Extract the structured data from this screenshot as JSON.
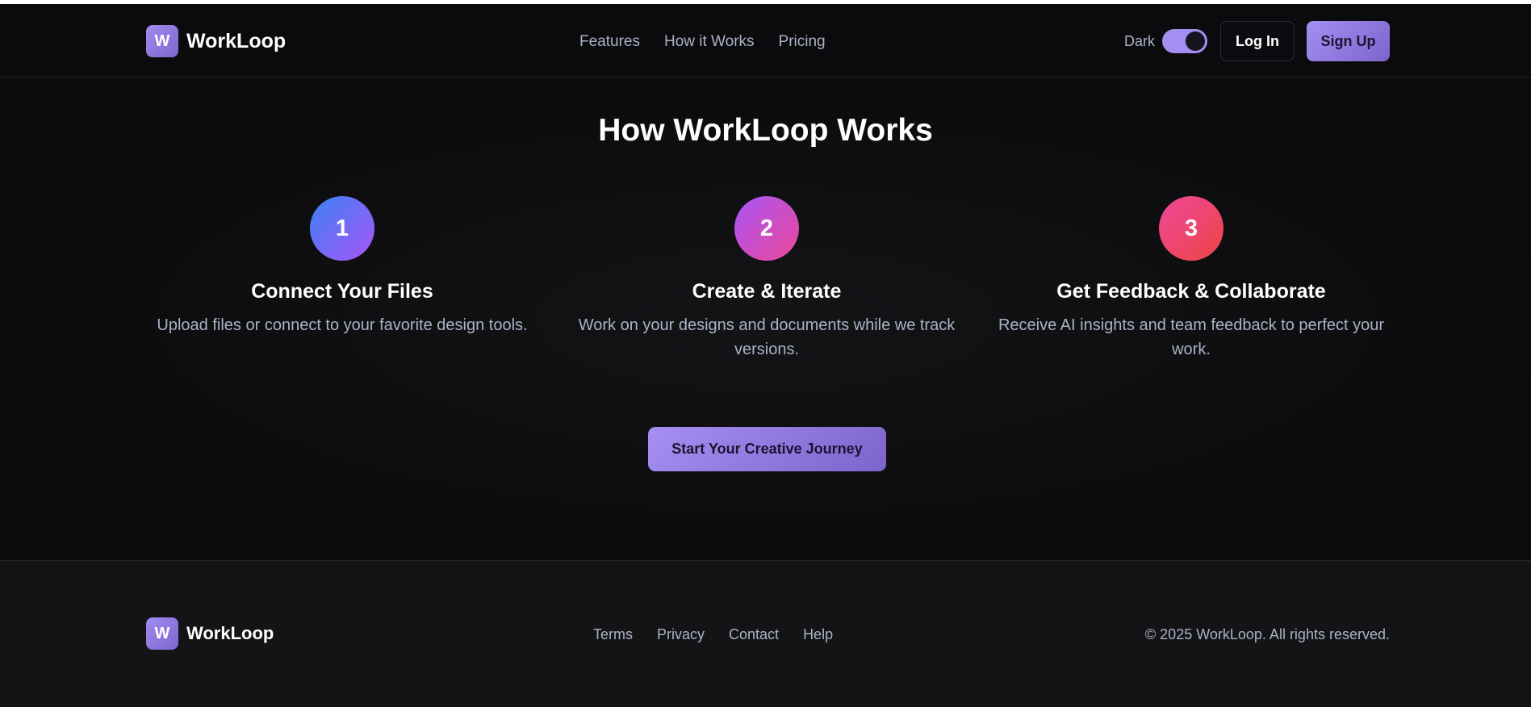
{
  "brand": {
    "logo_letter": "W",
    "name": "WorkLoop"
  },
  "nav": {
    "items": [
      "Features",
      "How it Works",
      "Pricing"
    ]
  },
  "header": {
    "theme_label": "Dark",
    "theme_toggle_on": true,
    "login_label": "Log In",
    "signup_label": "Sign Up"
  },
  "main": {
    "title": "How WorkLoop Works",
    "steps": [
      {
        "number": "1",
        "title": "Connect Your Files",
        "desc": "Upload files or connect to your favorite design tools."
      },
      {
        "number": "2",
        "title": "Create & Iterate",
        "desc": "Work on your designs and documents while we track versions."
      },
      {
        "number": "3",
        "title": "Get Feedback & Collaborate",
        "desc": "Receive AI insights and team feedback to perfect your work."
      }
    ],
    "cta_label": "Start Your Creative Journey"
  },
  "footer": {
    "links": [
      "Terms",
      "Privacy",
      "Contact",
      "Help"
    ],
    "copyright": "© 2025 WorkLoop. All rights reserved."
  },
  "colors": {
    "accent": "#a68ff2",
    "background": "#0d0d0f",
    "muted_text": "#a9b3c6"
  }
}
